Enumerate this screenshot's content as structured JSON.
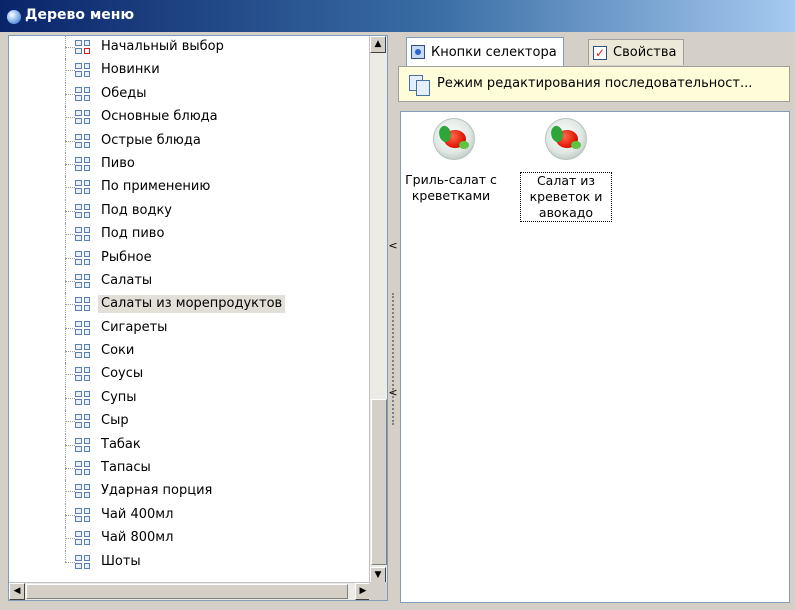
{
  "window": {
    "title": "Дерево меню"
  },
  "tree": {
    "items": [
      {
        "label": "Начальный выбор",
        "icon": "grid-red-icon"
      },
      {
        "label": "Новинки",
        "icon": "grid-icon"
      },
      {
        "label": "Обеды",
        "icon": "grid-icon"
      },
      {
        "label": "Основные блюда",
        "icon": "grid-icon"
      },
      {
        "label": "Острые блюда",
        "icon": "grid-icon"
      },
      {
        "label": "Пиво",
        "icon": "grid-icon"
      },
      {
        "label": "По применению",
        "icon": "grid-icon"
      },
      {
        "label": "Под водку",
        "icon": "grid-icon"
      },
      {
        "label": "Под пиво",
        "icon": "grid-icon"
      },
      {
        "label": "Рыбное",
        "icon": "grid-icon"
      },
      {
        "label": "Салаты",
        "icon": "grid-icon"
      },
      {
        "label": "Салаты из морепродуктов",
        "icon": "grid-icon",
        "selected": true
      },
      {
        "label": "Сигареты",
        "icon": "grid-icon"
      },
      {
        "label": "Соки",
        "icon": "grid-icon"
      },
      {
        "label": "Соусы",
        "icon": "grid-icon"
      },
      {
        "label": "Супы",
        "icon": "grid-icon"
      },
      {
        "label": "Сыр",
        "icon": "grid-icon"
      },
      {
        "label": "Табак",
        "icon": "grid-icon"
      },
      {
        "label": "Тапасы",
        "icon": "grid-icon"
      },
      {
        "label": "Ударная порция",
        "icon": "grid-icon"
      },
      {
        "label": "Чай 400мл",
        "icon": "grid-icon"
      },
      {
        "label": "Чай 800мл",
        "icon": "grid-icon"
      },
      {
        "label": "Шоты",
        "icon": "grid-icon"
      }
    ]
  },
  "tabs": [
    {
      "label": "Кнопки селектора",
      "active": true,
      "icon": "selector-icon"
    },
    {
      "label": "Свойства",
      "active": false,
      "icon": "properties-checkbox-icon"
    }
  ],
  "mode_banner": {
    "text": "Режим редактирования последовательност...",
    "icon": "sequence-pages-icon"
  },
  "selector_buttons": [
    {
      "label_lines": [
        "Гриль-салат с",
        "креветками"
      ],
      "icon": "salad-dish-icon",
      "focused": false
    },
    {
      "label_lines": [
        "Салат из",
        "креветок и",
        "авокадо"
      ],
      "icon": "salad-dish-icon",
      "focused": true
    }
  ],
  "colors": {
    "title_bar_start": "#0a246a",
    "title_bar_end": "#a6caf0",
    "banner_bg": "#fffcd9",
    "selection_bg": "#e2dfd8"
  }
}
